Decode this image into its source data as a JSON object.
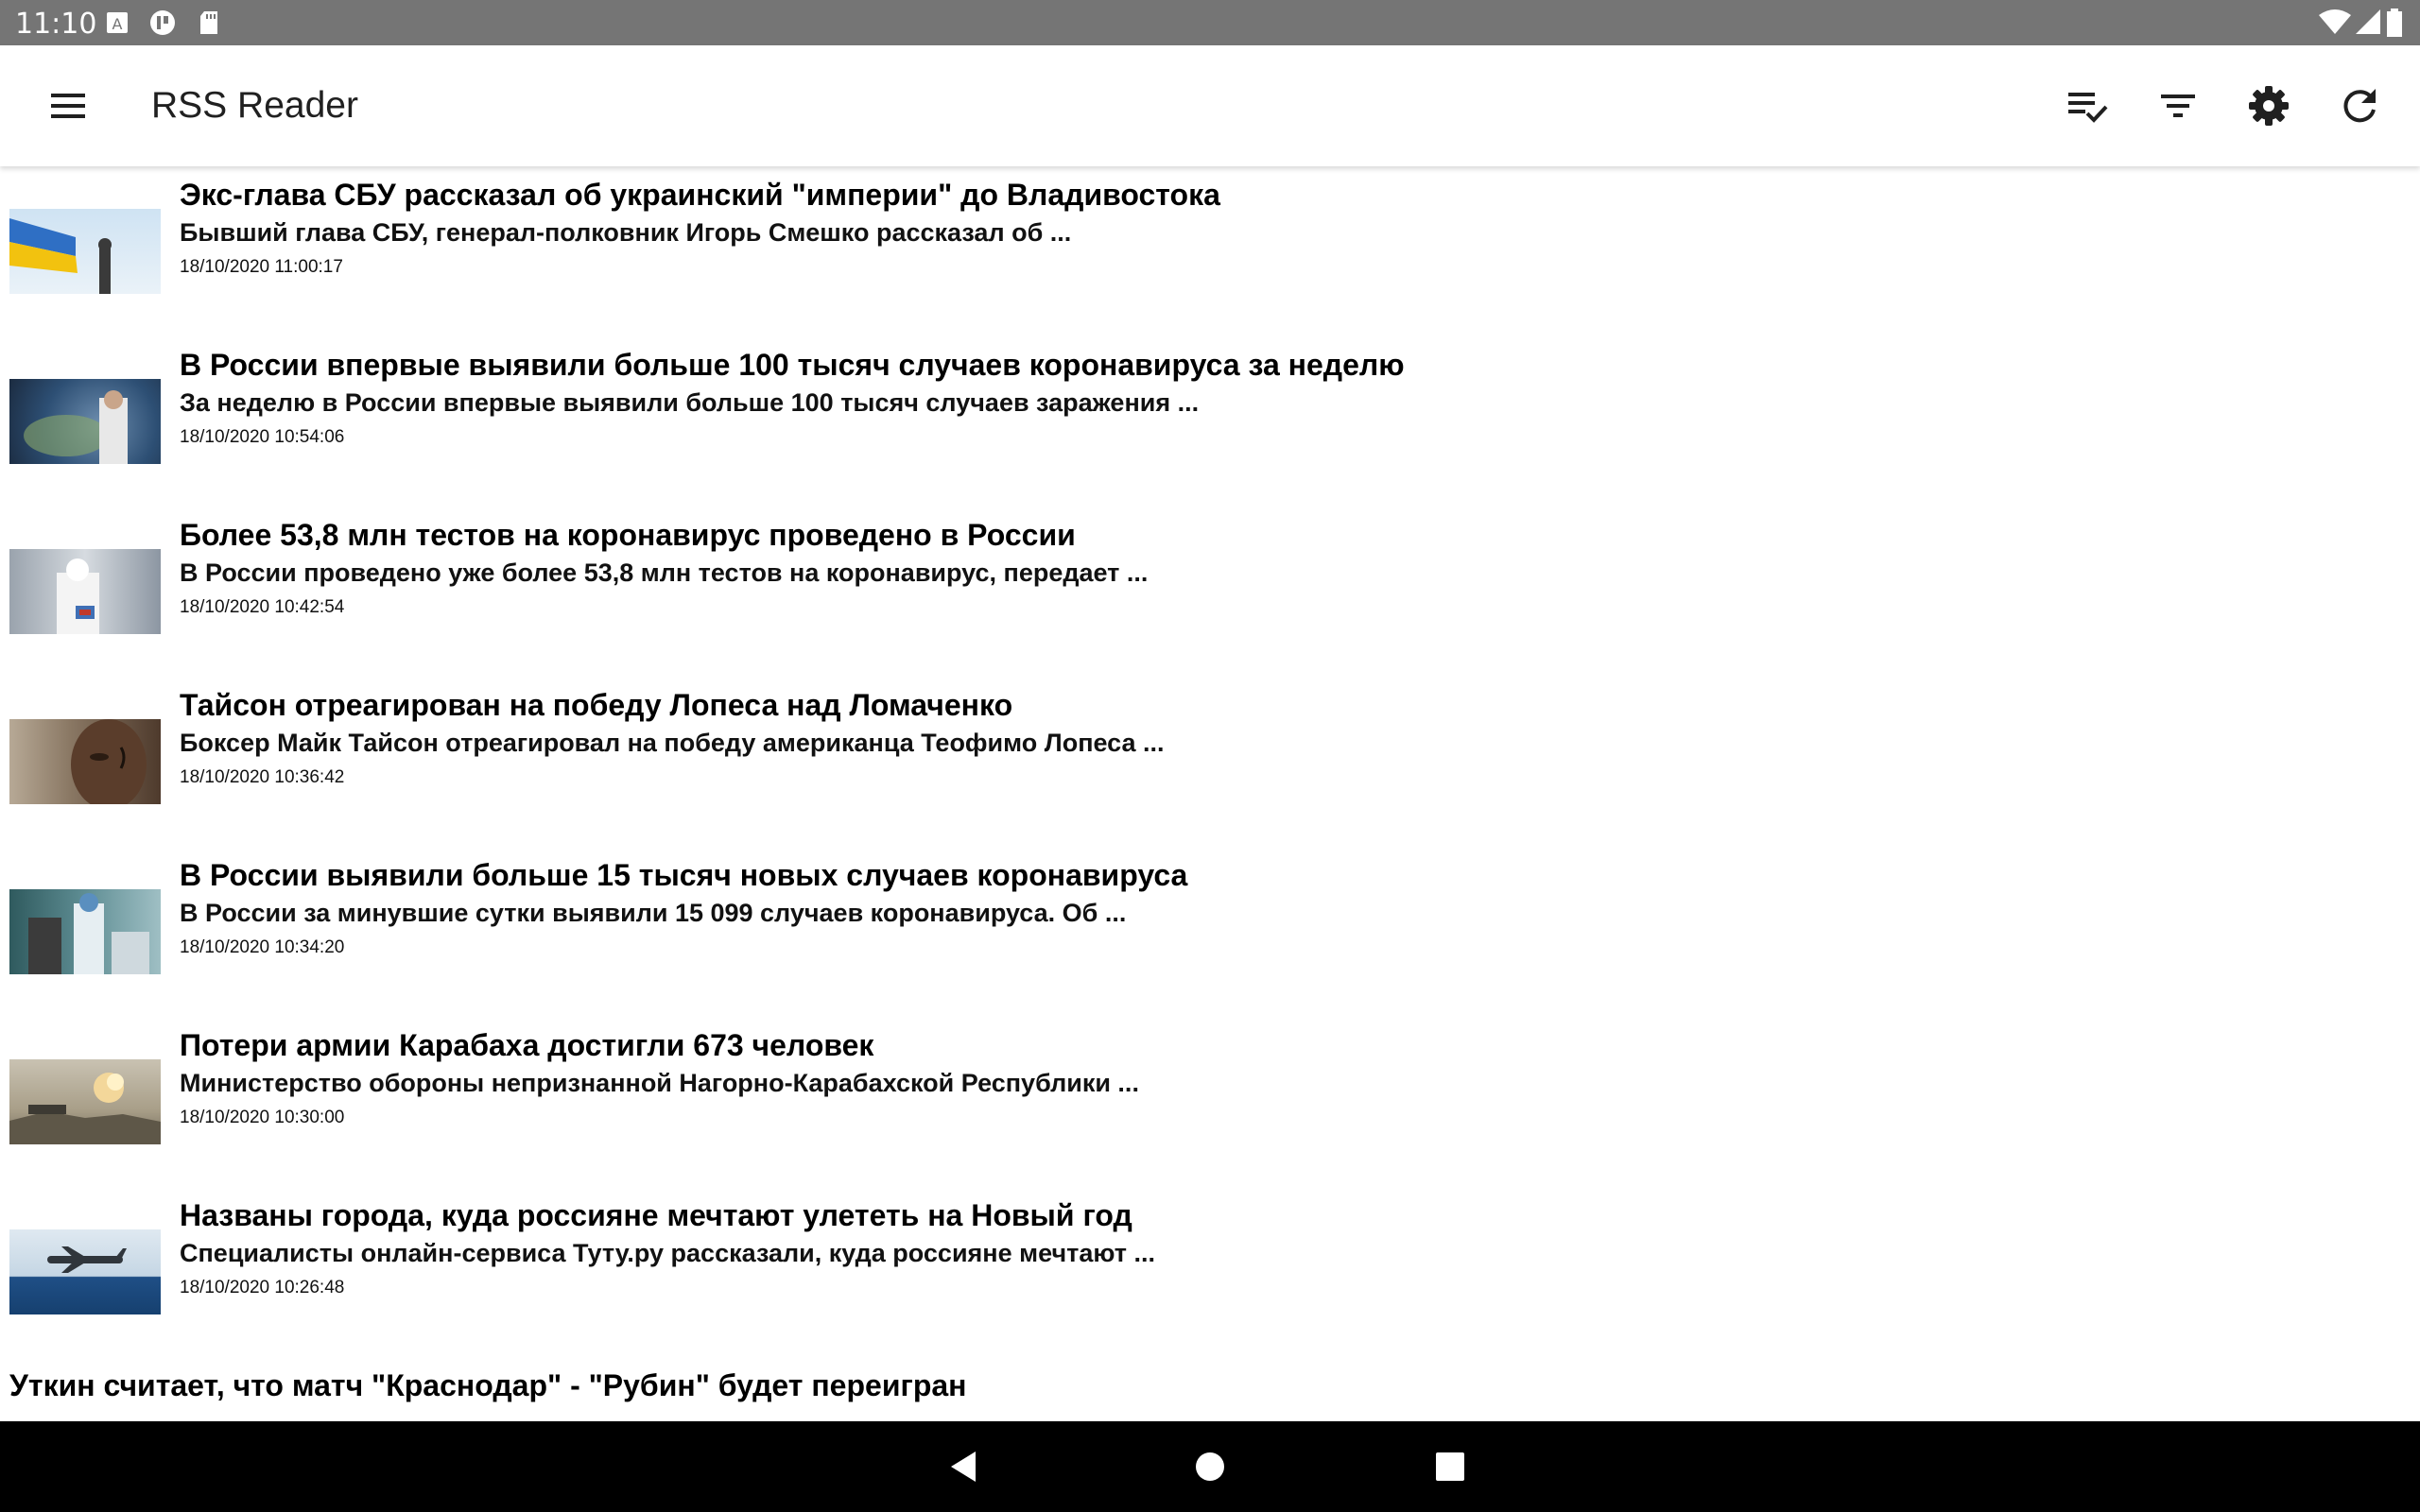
{
  "status_bar": {
    "time": "11:10"
  },
  "app_bar": {
    "title": "RSS Reader"
  },
  "articles": [
    {
      "title": "Экс-глава СБУ рассказал об украинский \"империи\" до Владивостока",
      "description": "Бывший глава СБУ, генерал-полковник Игорь Смешко рассказал об ...",
      "date": "18/10/2020 11:00:17"
    },
    {
      "title": "В России впервые выявили больше 100 тысяч случаев коронавируса за неделю",
      "description": "За неделю в России впервые выявили больше 100 тысяч случаев заражения ...",
      "date": "18/10/2020 10:54:06"
    },
    {
      "title": "Более 53,8 млн тестов на коронавирус проведено в России",
      "description": "В России проведено уже более 53,8 млн тестов на коронавирус, передает ...",
      "date": "18/10/2020 10:42:54"
    },
    {
      "title": "Тайсон отреагирован на победу Лопеса над Ломаченко",
      "description": "Боксер Майк Тайсон отреагировал на победу американца Теофимо Лопеса ...",
      "date": "18/10/2020 10:36:42"
    },
    {
      "title": "В России выявили больше 15 тысяч новых случаев коронавируса",
      "description": "В России за минувшие сутки выявили 15 099 случаев коронавируса. Об ...",
      "date": "18/10/2020 10:34:20"
    },
    {
      "title": "Потери армии Карабаха достигли 673 человек",
      "description": "Министерство обороны непризнанной Нагорно-Карабахской Республики ...",
      "date": "18/10/2020 10:30:00"
    },
    {
      "title": "Названы города, куда россияне мечтают улететь на Новый год",
      "description": "Специалисты онлайн-сервиса Туту.ру рассказали, куда россияне мечтают ...",
      "date": "18/10/2020 10:26:48"
    },
    {
      "title": "Уткин считает, что матч \"Краснодар\" - \"Рубин\" будет переигран",
      "description": "",
      "date": ""
    }
  ],
  "icons": {
    "menu": "menu-icon",
    "mark_read": "playlist-check-icon",
    "filter": "filter-icon",
    "settings": "gear-icon",
    "refresh": "refresh-icon",
    "back": "back-icon",
    "home": "home-icon",
    "recents": "recents-icon"
  },
  "colors": {
    "status_bar": "#757575",
    "nav_bar": "#000000",
    "app_bar": "#ffffff"
  }
}
